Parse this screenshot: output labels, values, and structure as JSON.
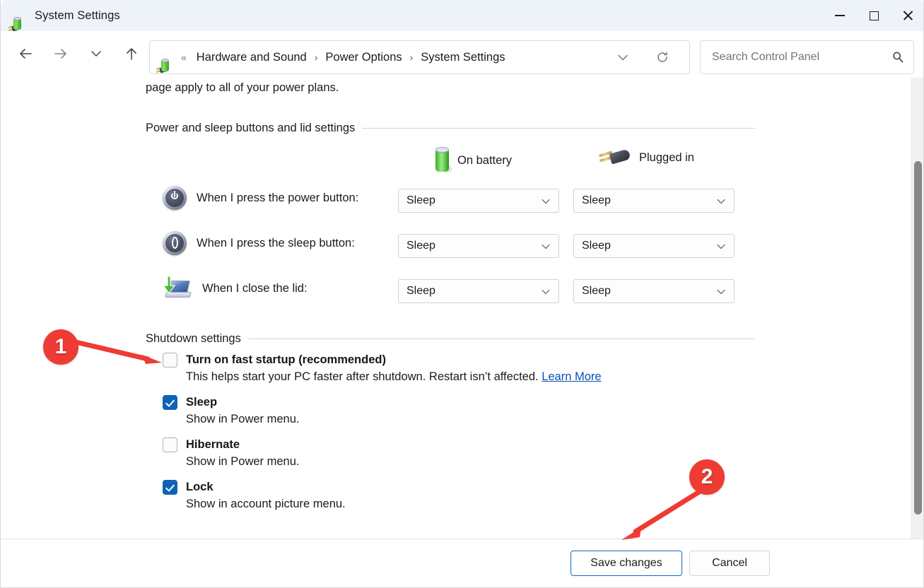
{
  "window": {
    "title": "System Settings",
    "title_icon": "battery-plug-icon",
    "controls": {
      "minimize": "minimize-icon",
      "maximize": "maximize-icon",
      "close": "close-icon"
    }
  },
  "nav": {
    "back": "back-arrow-icon",
    "forward": "forward-arrow-icon",
    "recent": "chevron-down-icon",
    "up": "up-arrow-icon",
    "dropdown": "chevron-down-icon",
    "refresh": "refresh-icon"
  },
  "breadcrumb": {
    "icon": "battery-plug-icon",
    "overflow": "«",
    "separator": "›",
    "segments": [
      "Hardware and Sound",
      "Power Options",
      "System Settings"
    ]
  },
  "search": {
    "placeholder": "Search Control Panel",
    "value": "",
    "icon": "search-icon"
  },
  "content": {
    "intro_text": "page apply to all of your power plans.",
    "power_group": {
      "header": "Power and sleep buttons and lid settings",
      "columns": [
        {
          "label": "On battery",
          "icon": "battery-icon"
        },
        {
          "label": "Plugged in",
          "icon": "power-plug-icon"
        }
      ],
      "rows": [
        {
          "icon": "power-button-icon",
          "label": "When I press the power button:",
          "on_battery": "Sleep",
          "plugged_in": "Sleep"
        },
        {
          "icon": "sleep-button-icon",
          "label": "When I press the sleep button:",
          "on_battery": "Sleep",
          "plugged_in": "Sleep"
        },
        {
          "icon": "laptop-lid-icon",
          "label": "When I close the lid:",
          "on_battery": "Sleep",
          "plugged_in": "Sleep"
        }
      ]
    },
    "shutdown_group": {
      "header": "Shutdown settings",
      "items": [
        {
          "title": "Turn on fast startup (recommended)",
          "checked": false,
          "description": "This helps start your PC faster after shutdown. Restart isn’t affected.",
          "link": "Learn More"
        },
        {
          "title": "Sleep",
          "checked": true,
          "description": "Show in Power menu.",
          "link": ""
        },
        {
          "title": "Hibernate",
          "checked": false,
          "description": "Show in Power menu.",
          "link": ""
        },
        {
          "title": "Lock",
          "checked": true,
          "description": "Show in account picture menu.",
          "link": ""
        }
      ]
    }
  },
  "footer": {
    "save_label": "Save changes",
    "cancel_label": "Cancel"
  },
  "annotations": [
    {
      "number": "1",
      "color": "#ee3b33",
      "points_to": "Turn on fast startup (recommended)"
    },
    {
      "number": "2",
      "color": "#ee3b33",
      "points_to": "Save changes"
    }
  ]
}
